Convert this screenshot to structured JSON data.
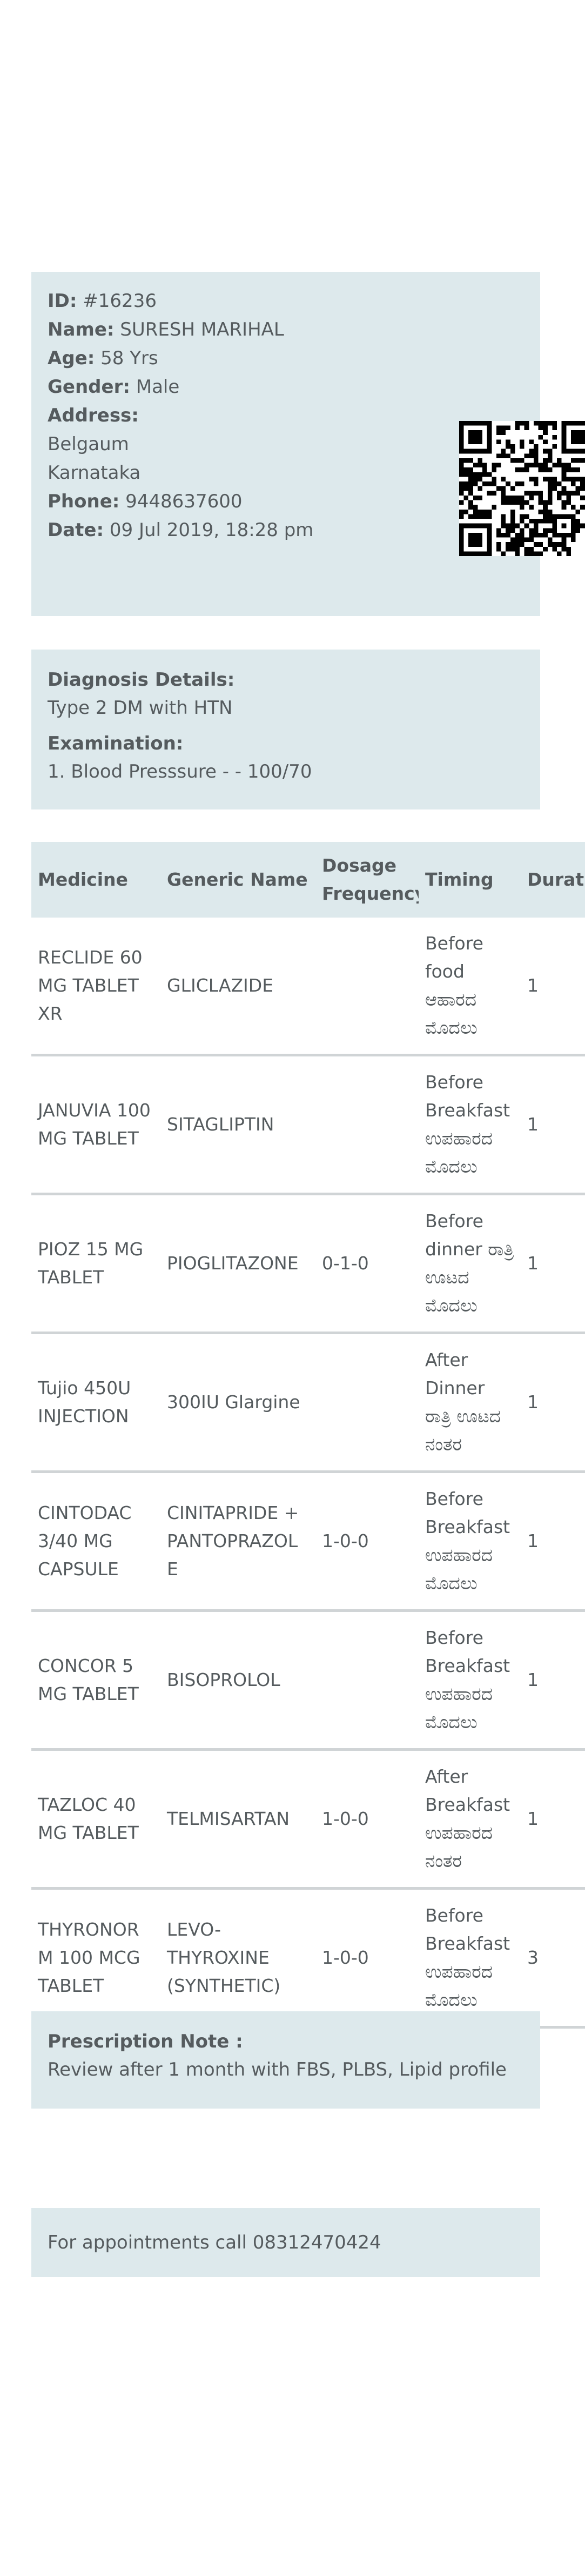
{
  "patient": {
    "id_label": "ID:",
    "id_value": "#16236",
    "name_label": "Name:",
    "name_value": "SURESH MARIHAL",
    "age_label": "Age:",
    "age_value": "58 Yrs",
    "gender_label": "Gender:",
    "gender_value": "Male",
    "address_label": "Address:",
    "address_line1": "Belgaum",
    "address_line2": "Karnataka",
    "phone_label": "Phone:",
    "phone_value": "9448637600",
    "date_label": "Date:",
    "date_value": "09 Jul 2019, 18:28 pm"
  },
  "qr": {
    "icon": "qr-code-icon"
  },
  "diagnosis": {
    "diagnosis_label": "Diagnosis Details:",
    "diagnosis_value": "Type 2 DM with HTN",
    "examination_label": "Examination:",
    "examination_value": "1. Blood Presssure - - 100/70"
  },
  "medicines": {
    "headers": {
      "medicine": "Medicine",
      "generic": "Generic Name",
      "dosage": "Dosage Frequency",
      "timing": "Timing",
      "duration": "Durat"
    },
    "rows": [
      {
        "medicine": "RECLIDE 60 MG TABLET XR",
        "generic": "GLICLAZIDE",
        "dosage": "",
        "timing": "Before food ಆಹಾರದ ಮೊದಲು",
        "duration": "1"
      },
      {
        "medicine": "JANUVIA 100 MG TABLET",
        "generic": "SITAGLIPTIN",
        "dosage": "",
        "timing": "Before Breakfast ಉಪಹಾರದ ಮೊದಲು",
        "duration": "1"
      },
      {
        "medicine": "PIOZ 15 MG TABLET",
        "generic": "PIOGLITAZONE",
        "dosage": "0-1-0",
        "timing": "Before dinner ರಾತ್ರಿ ಊಟದ ಮೊದಲು",
        "duration": "1"
      },
      {
        "medicine": "Tujio 450U INJECTION",
        "generic": "300IU Glargine",
        "dosage": "",
        "timing": "After Dinner ರಾತ್ರಿ ಊಟದ ನಂತರ",
        "duration": "1"
      },
      {
        "medicine": "CINTODAC 3/40 MG CAPSULE",
        "generic": "CINITAPRIDE + PANTOPRAZOLE",
        "dosage": "1-0-0",
        "timing": "Before Breakfast ಉಪಹಾರದ ಮೊದಲು",
        "duration": "1"
      },
      {
        "medicine": "CONCOR 5 MG TABLET",
        "generic": "BISOPROLOL",
        "dosage": "",
        "timing": "Before Breakfast ಉಪಹಾರದ ಮೊದಲು",
        "duration": "1"
      },
      {
        "medicine": "TAZLOC 40 MG TABLET",
        "generic": "TELMISARTAN",
        "dosage": "1-0-0",
        "timing": "After Breakfast ಉಪಹಾರದ ನಂತರ",
        "duration": "1"
      },
      {
        "medicine": "THYRONORM 100 MCG TABLET",
        "generic": "LEVO-THYROXINE (SYNTHETIC)",
        "dosage": "1-0-0",
        "timing": "Before Breakfast ಉಪಹಾರದ ಮೊದಲು",
        "duration": "3"
      }
    ]
  },
  "note": {
    "label": "Prescription Note :",
    "value": "Review after 1 month with FBS, PLBS, Lipid profile"
  },
  "appointment": {
    "text": "For appointments call 08312470424"
  },
  "colors": {
    "card_background": "#dde9ec",
    "text": "#555b5e",
    "row_divider": "#d0d4d6"
  }
}
